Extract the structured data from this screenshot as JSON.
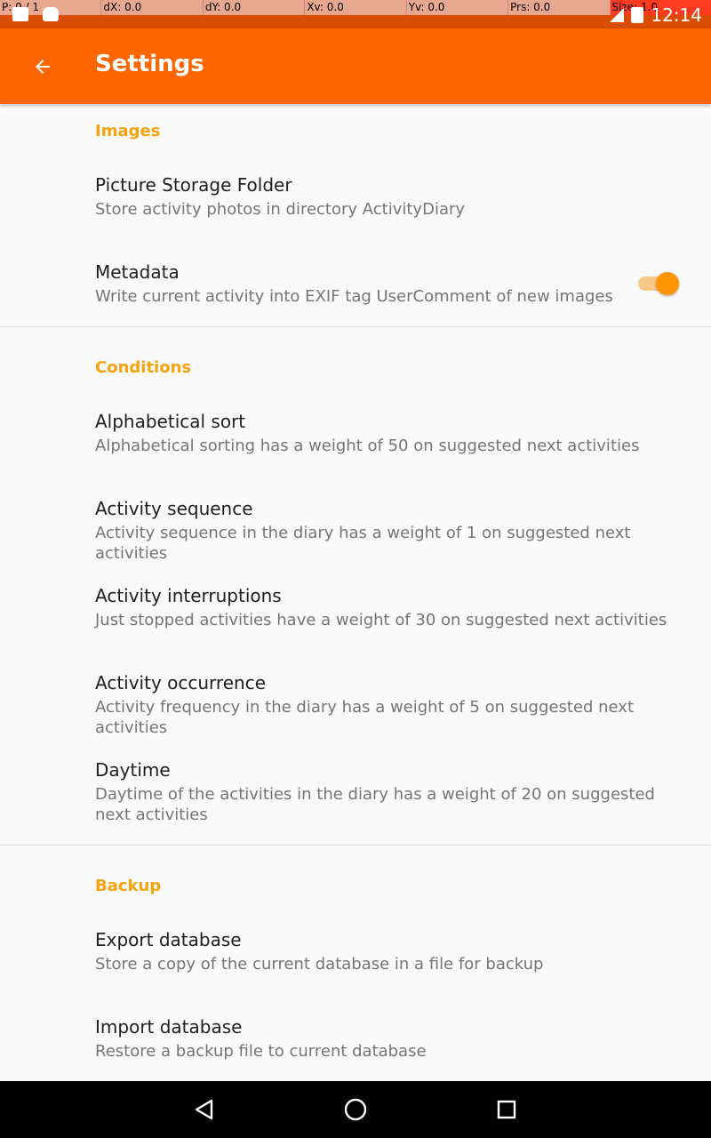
{
  "status_bar": {
    "pointer": {
      "p": "P: 0 / 1",
      "dx": "dX: 0.0",
      "dy": "dY: 0.0",
      "xv": "Xv: 0.0",
      "yv": "Yv: 0.0",
      "prs": "Prs: 0.0",
      "size": "Size: 1.0"
    },
    "time": "12:14"
  },
  "toolbar": {
    "title": "Settings",
    "back_icon": "arrow-back-icon"
  },
  "sections": {
    "images": {
      "header": "Images",
      "picture_storage": {
        "title": "Picture Storage Folder",
        "summary": "Store activity photos in directory ActivityDiary"
      },
      "metadata": {
        "title": "Metadata",
        "summary": "Write current activity into EXIF tag UserComment of new images",
        "switch_on": true
      }
    },
    "conditions": {
      "header": "Conditions",
      "alphabetical": {
        "title": "Alphabetical sort",
        "summary": "Alphabetical sorting has a weight of 50 on suggested next activities"
      },
      "sequence": {
        "title": "Activity sequence",
        "summary": "Activity sequence in the diary has a weight of 1 on suggested next activities"
      },
      "interruptions": {
        "title": "Activity interruptions",
        "summary": "Just stopped activities have a weight of 30 on suggested next activities"
      },
      "occurrence": {
        "title": "Activity occurrence",
        "summary": "Activity frequency in the diary has a weight of 5 on suggested next activities"
      },
      "daytime": {
        "title": "Daytime",
        "summary": "Daytime of the activities in the diary has a weight of 20 on suggested next activities"
      }
    },
    "backup": {
      "header": "Backup",
      "export": {
        "title": "Export database",
        "summary": "Store a copy of the current database in a file for backup"
      },
      "import": {
        "title": "Import database",
        "summary": "Restore a backup file to current database"
      }
    }
  },
  "colors": {
    "primary": "#ff6600",
    "status_bar": "#d84d00",
    "accent": "#f5a30f",
    "switch_thumb": "#ff9500"
  },
  "nav_bar": {
    "back_icon": "nav-back-icon",
    "home_icon": "nav-home-icon",
    "recents_icon": "nav-recents-icon"
  }
}
